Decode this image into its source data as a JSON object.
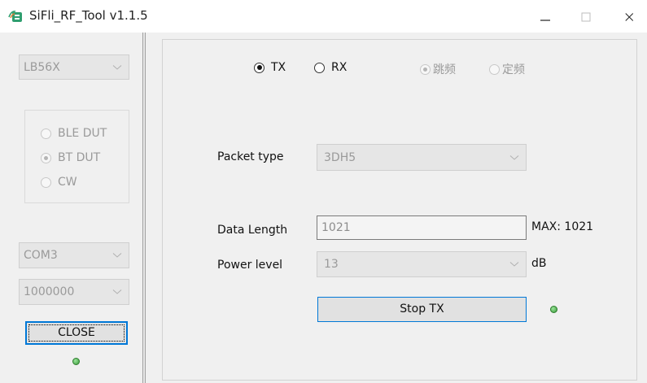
{
  "window": {
    "title": "SiFli_RF_Tool v1.1.5"
  },
  "sidebar": {
    "chip_select": {
      "value": "LB56X"
    },
    "mode_group": {
      "options": [
        {
          "label": "BLE DUT",
          "selected": false
        },
        {
          "label": "BT DUT",
          "selected": true
        },
        {
          "label": "CW",
          "selected": false
        }
      ]
    },
    "port_select": {
      "value": "COM3"
    },
    "baud_select": {
      "value": "1000000"
    },
    "close_button": {
      "label": "CLOSE"
    },
    "status_led": "#3a9b3a"
  },
  "main": {
    "direction": {
      "tx_label": "TX",
      "rx_label": "RX",
      "selected": "TX"
    },
    "frequency_mode": {
      "hopping_label": "跳频",
      "fixed_label": "定频",
      "selected": "hopping"
    },
    "packet_type": {
      "label": "Packet type",
      "value": "3DH5"
    },
    "data_length": {
      "label": "Data Length",
      "value": "1021",
      "max_label": "MAX: 1021"
    },
    "power_level": {
      "label": "Power level",
      "value": "13",
      "unit": "dB"
    },
    "stop_button": {
      "label": "Stop TX"
    },
    "tx_led": "#3a9b3a"
  },
  "colors": {
    "accent_blue": "#0078d7",
    "disabled_text": "#9a9a9a"
  }
}
